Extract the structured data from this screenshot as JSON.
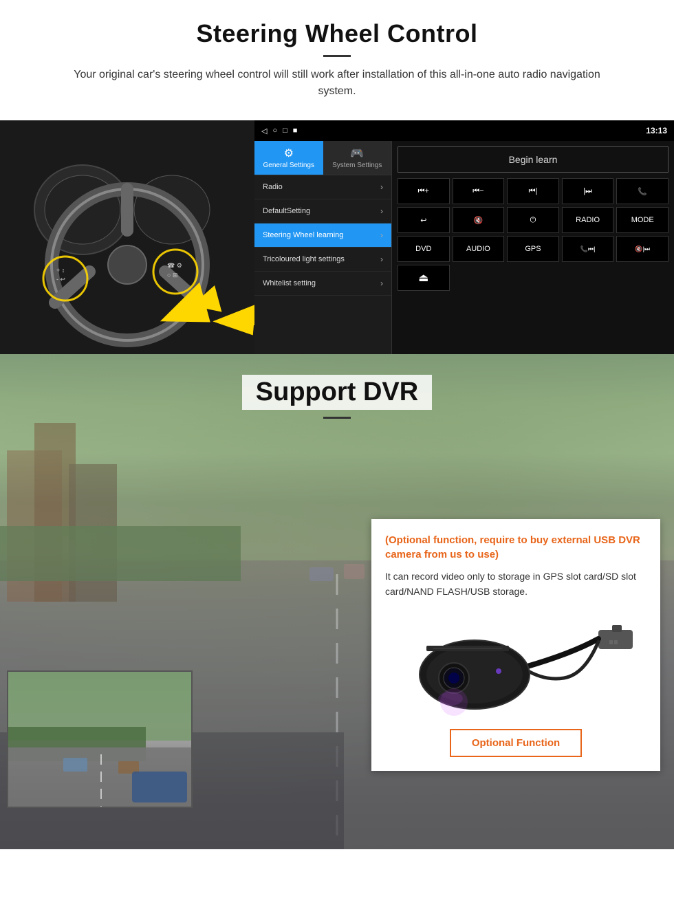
{
  "page": {
    "section1": {
      "title": "Steering Wheel Control",
      "subtitle": "Your original car's steering wheel control will still work after installation of this all-in-one auto radio navigation system.",
      "statusbar": {
        "time": "13:13",
        "icons": [
          "◁",
          "○",
          "□",
          "■"
        ]
      },
      "tabs": [
        {
          "id": "general",
          "label": "General Settings",
          "icon": "⚙",
          "active": true
        },
        {
          "id": "system",
          "label": "System Settings",
          "icon": "🎮",
          "active": false
        }
      ],
      "menu_items": [
        {
          "id": "radio",
          "label": "Radio",
          "active": false
        },
        {
          "id": "default",
          "label": "DefaultSetting",
          "active": false
        },
        {
          "id": "steering",
          "label": "Steering Wheel learning",
          "active": true
        },
        {
          "id": "tricolour",
          "label": "Tricoloured light settings",
          "active": false
        },
        {
          "id": "whitelist",
          "label": "Whitelist setting",
          "active": false
        }
      ],
      "begin_learn_label": "Begin learn",
      "control_buttons": [
        "⏮+",
        "⏮-",
        "⏮|",
        "⏭|",
        "📞",
        "↩",
        "🔇",
        "⏻",
        "RADIO",
        "MODE",
        "DVD",
        "AUDIO",
        "GPS",
        "📞⏮|",
        "🔇⏭|"
      ]
    },
    "section2": {
      "title": "Support DVR",
      "info_title": "(Optional function, require to buy external USB DVR camera from us to use)",
      "info_body": "It can record video only to storage in GPS slot card/SD slot card/NAND FLASH/USB storage.",
      "optional_function_label": "Optional Function"
    }
  }
}
